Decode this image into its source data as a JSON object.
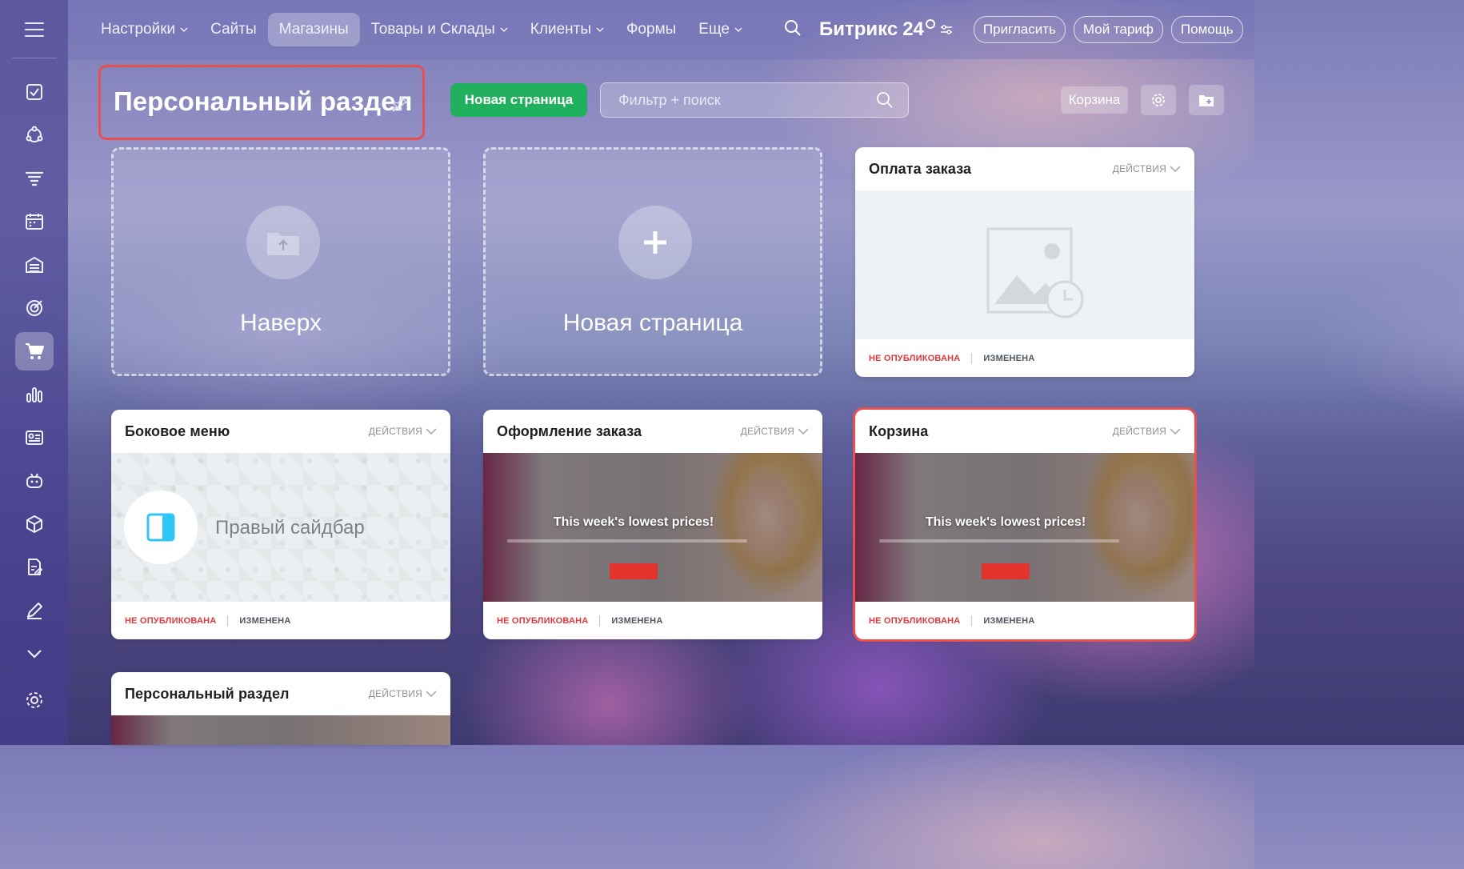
{
  "topnav": {
    "items": [
      {
        "label": "Настройки",
        "dropdown": true
      },
      {
        "label": "Сайты",
        "dropdown": false
      },
      {
        "label": "Магазины",
        "dropdown": false,
        "active": true
      },
      {
        "label": "Товары и Склады",
        "dropdown": true
      },
      {
        "label": "Клиенты",
        "dropdown": true
      },
      {
        "label": "Формы",
        "dropdown": false
      },
      {
        "label": "Еще",
        "dropdown": true
      }
    ],
    "brand": "Битрикс",
    "brand_number": "24",
    "invite": "Пригласить",
    "tariff": "Мой тариф",
    "help": "Помощь"
  },
  "sidebar": {
    "icons": [
      "tasks-icon",
      "crm-icon",
      "funnel-icon",
      "calendar-icon",
      "warehouse-icon",
      "target-icon",
      "cart-icon",
      "analytics-icon",
      "contacts-card-icon",
      "robot-icon",
      "box-icon",
      "document-edit-icon",
      "pen-icon",
      "chevron-down-icon"
    ],
    "active": "cart-icon"
  },
  "page": {
    "title": "Персональный раздел",
    "new_page_button": "Новая страница",
    "filter_placeholder": "Фильтр + поиск",
    "cart_button": "Корзина"
  },
  "tiles": {
    "up": "Наверх",
    "new_page": "Новая страница"
  },
  "cards": [
    {
      "title": "Оплата заказа",
      "actions": "ДЕЙСТВИЯ",
      "status": "НЕ ОПУБЛИКОВАНА",
      "modified": "ИЗМЕНЕНА",
      "preview": "empty"
    },
    {
      "title": "Боковое меню",
      "actions": "ДЕЙСТВИЯ",
      "status": "НЕ ОПУБЛИКОВАНА",
      "modified": "ИЗМЕНЕНА",
      "preview": "sidebar",
      "preview_label": "Правый сайдбар"
    },
    {
      "title": "Оформление заказа",
      "actions": "ДЕЙСТВИЯ",
      "status": "НЕ ОПУБЛИКОВАНА",
      "modified": "ИЗМЕНЕНА",
      "preview": "promo",
      "promo_text": "This week's lowest prices!"
    },
    {
      "title": "Корзина",
      "actions": "ДЕЙСТВИЯ",
      "status": "НЕ ОПУБЛИКОВАНА",
      "modified": "ИЗМЕНЕНА",
      "preview": "promo",
      "promo_text": "This week's lowest prices!",
      "selected": true
    },
    {
      "title": "Персональный раздел",
      "actions": "ДЕЙСТВИЯ"
    }
  ],
  "colors": {
    "accent_green": "#21b05e",
    "highlight_red": "#e8504f",
    "status_red": "#e0383b"
  }
}
